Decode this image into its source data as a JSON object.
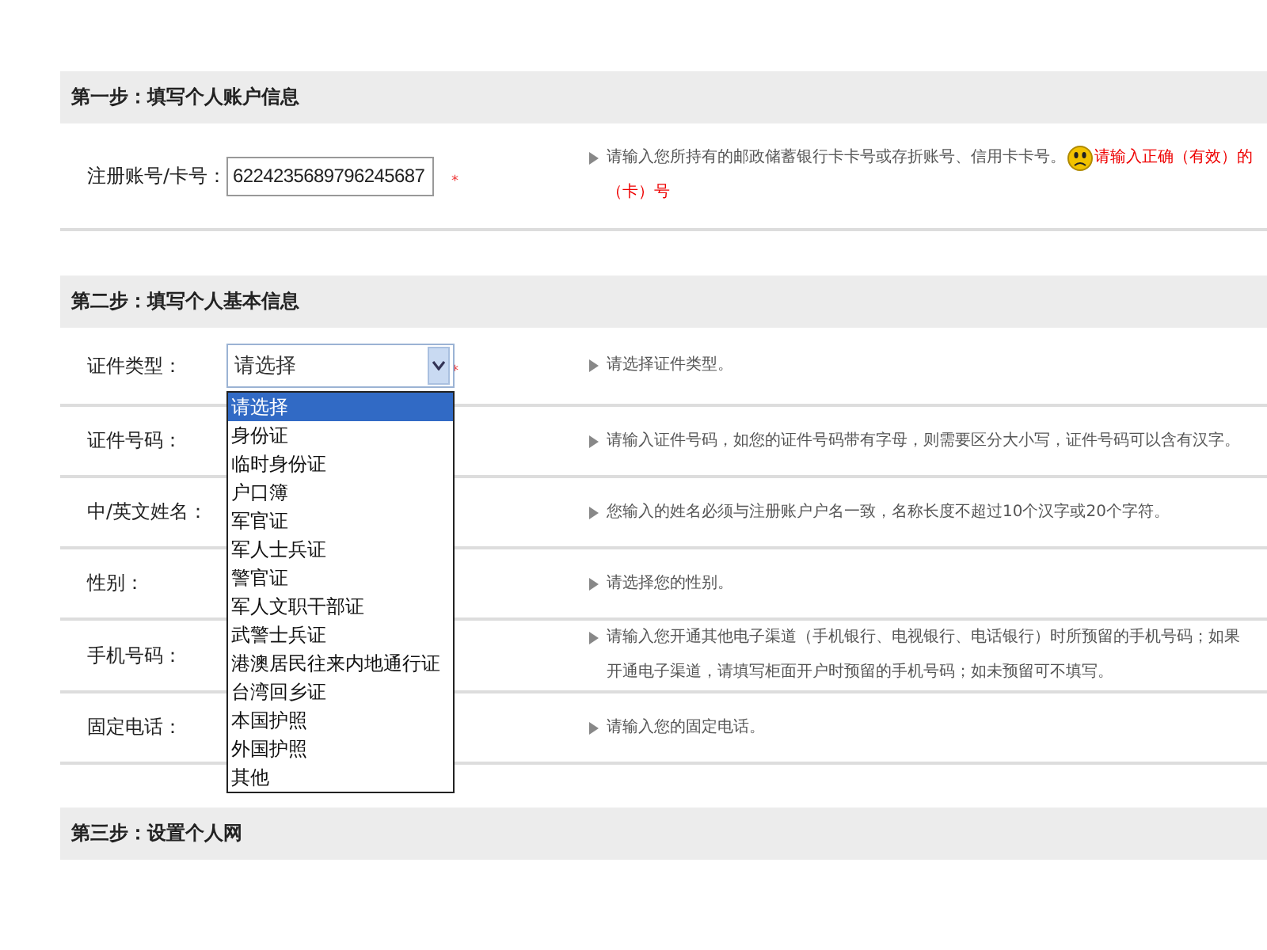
{
  "steps": [
    {
      "title": "第一步：填写个人账户信息",
      "rows": [
        {
          "kind": "input",
          "label": "注册账号/卡号：",
          "value": "6224235689796245687",
          "required": true,
          "required_mark": "*",
          "hint": [
            "请输入您所持有的邮政储蓄银行卡卡号或存折账号、信用卡卡号。"
          ],
          "error": [
            "请输入正确（有效）的",
            "（卡）号"
          ]
        }
      ]
    },
    {
      "title": "第二步：填写个人基本信息",
      "rows": [
        {
          "kind": "select",
          "label": "证件类型：",
          "value": "请选择",
          "required": true,
          "required_mark": "*",
          "expanded": true,
          "hint": [
            "请选择证件类型。"
          ],
          "options": [
            {
              "label": "请选择",
              "selected": true
            },
            {
              "label": "身份证",
              "selected": false
            },
            {
              "label": "临时身份证",
              "selected": false
            },
            {
              "label": "户口簿",
              "selected": false
            },
            {
              "label": "军官证",
              "selected": false
            },
            {
              "label": "军人士兵证",
              "selected": false
            },
            {
              "label": "警官证",
              "selected": false
            },
            {
              "label": "军人文职干部证",
              "selected": false
            },
            {
              "label": "武警士兵证",
              "selected": false
            },
            {
              "label": "港澳居民往来内地通行证",
              "selected": false
            },
            {
              "label": "台湾回乡证",
              "selected": false
            },
            {
              "label": "本国护照",
              "selected": false
            },
            {
              "label": "外国护照",
              "selected": false
            },
            {
              "label": "其他",
              "selected": false
            }
          ]
        },
        {
          "kind": "plain",
          "label": "证件号码：",
          "hint": [
            "请输入证件号码，如您的证件号码带有字母，则需要区分大小写，证件号码可以含有汉字。"
          ]
        },
        {
          "kind": "plain",
          "label": "中/英文姓名：",
          "hint": [
            "您输入的姓名必须与注册账户户名一致，名称长度不超过10个汉字或20个字符。"
          ]
        },
        {
          "kind": "plain",
          "label": "性别：",
          "hint": [
            "请选择您的性别。"
          ]
        },
        {
          "kind": "plain",
          "label": "手机号码：",
          "hint": [
            "请输入您开通其他电子渠道（手机银行、电视银行、电话银行）时所预留的手机号码；如果",
            "开通电子渠道，请填写柜面开户时预留的手机号码；如未预留可不填写。"
          ]
        },
        {
          "kind": "plain",
          "label": "固定电话：",
          "hint": [
            "请输入您的固定电话。"
          ]
        }
      ]
    },
    {
      "title": "第三步：设置个人网"
    }
  ]
}
